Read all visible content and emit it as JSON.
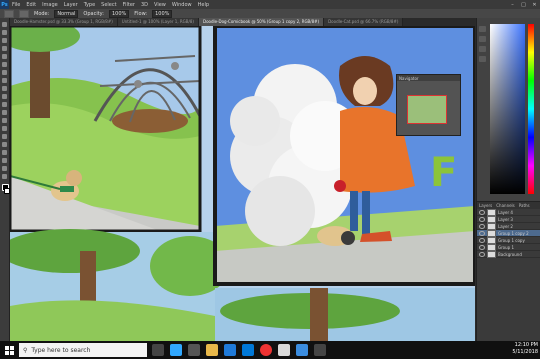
{
  "menubar": {
    "logo": "Ps",
    "items": [
      "File",
      "Edit",
      "Image",
      "Layer",
      "Type",
      "Select",
      "Filter",
      "3D",
      "View",
      "Window",
      "Help"
    ],
    "window_controls": [
      "–",
      "□",
      "✕"
    ]
  },
  "optbar": {
    "mode_label": "Mode:",
    "mode_value": "Normal",
    "opacity_label": "Opacity:",
    "opacity_value": "100%",
    "flow_label": "Flow:",
    "flow_value": "100%"
  },
  "tabs": [
    {
      "label": "Doodle-Hamster.psd @ 33.3% (Group 1, RGB/8#)",
      "active": false
    },
    {
      "label": "Untitled-1 @ 100% (Layer 1, RGB/8)",
      "active": false
    },
    {
      "label": "Doodle-Dog-Comicbook @ 50% (Group 1 copy 2, RGB/8#)",
      "active": true
    },
    {
      "label": "Doodle-Cat.psd @ 66.7% (RGB/8#)",
      "active": false
    }
  ],
  "navigator": {
    "title": "Navigator"
  },
  "layers": {
    "tabs": [
      "Layers",
      "Channels",
      "Paths"
    ],
    "rows": [
      {
        "name": "Layer 4",
        "selected": false
      },
      {
        "name": "Layer 3",
        "selected": false
      },
      {
        "name": "Layer 2",
        "selected": false
      },
      {
        "name": "Group 1 copy 2",
        "selected": true
      },
      {
        "name": "Group 1 copy",
        "selected": false
      },
      {
        "name": "Group 1",
        "selected": false
      },
      {
        "name": "Background",
        "selected": false
      }
    ]
  },
  "taskbar": {
    "search_placeholder": "Type here to search",
    "time": "12:10 PM",
    "date": "5/11/2018"
  },
  "colors": {
    "accent": "#31a8ff",
    "panel": "#424242",
    "canvas_border": "#1a1a1a",
    "coat": "#e8742b"
  }
}
